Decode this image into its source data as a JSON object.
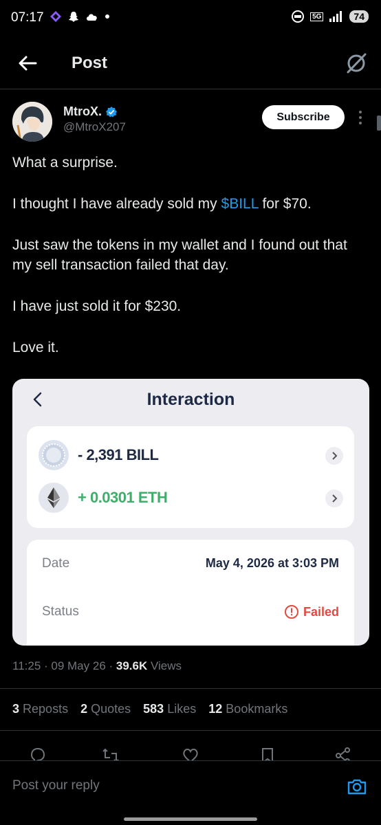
{
  "status_bar": {
    "time": "07:17",
    "network": "5G",
    "battery": "74"
  },
  "header": {
    "title": "Post"
  },
  "author": {
    "name": "MtroX.",
    "handle": "@MtroX207",
    "subscribe_label": "Subscribe"
  },
  "post": {
    "line1": "What a surprise.",
    "line2_before": "I thought I have already sold my ",
    "line2_cashtag": "$BILL",
    "line2_after": " for $70.",
    "line3": "Just saw the tokens in my wallet and I found out that my sell transaction failed that day.",
    "line4": "I have just sold it for $230.",
    "line5": "Love it."
  },
  "card": {
    "title": "Interaction",
    "tx": [
      {
        "amount": "- 2,391 BILL",
        "color": "#1e2a44"
      },
      {
        "amount": "+ 0.0301 ETH",
        "color": "#3fae6a"
      }
    ],
    "date_label": "Date",
    "date_value": "May 4, 2026 at 3:03 PM",
    "status_label": "Status",
    "status_value": "Failed",
    "failed_color": "#e5483f"
  },
  "meta": {
    "time": "11:25",
    "date": "09 May 26",
    "views_count": "39.6K",
    "views_label": "Views"
  },
  "stats": {
    "reposts_count": "3",
    "reposts_label": "Reposts",
    "quotes_count": "2",
    "quotes_label": "Quotes",
    "likes_count": "583",
    "likes_label": "Likes",
    "bookmarks_count": "12",
    "bookmarks_label": "Bookmarks"
  },
  "reply": {
    "placeholder": "Post your reply"
  },
  "colors": {
    "accent": "#1d9bf0",
    "muted": "#71767b"
  }
}
